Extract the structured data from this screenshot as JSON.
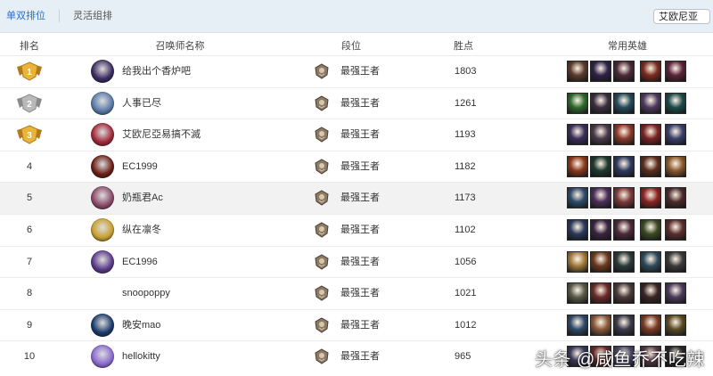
{
  "tabs": [
    {
      "label": "单双排位",
      "active": true
    },
    {
      "label": "灵活组排",
      "active": false
    }
  ],
  "server_select": {
    "value": "艾欧尼亚"
  },
  "columns": {
    "rank": "排名",
    "summoner": "召唤师名称",
    "tier": "段位",
    "points": "胜点",
    "heroes": "常用英雄"
  },
  "colors": {
    "accent": "#2b6fc2",
    "gold_medal": "#e8b43a",
    "silver_medal": "#b9b9b9",
    "row_highlight": "#f2f2f2"
  },
  "icons": {
    "tier": "challenger-crest-icon",
    "medal": "rank-medal-icon"
  },
  "rows": [
    {
      "rank": "1",
      "medal": "gold",
      "name": "给我出个香炉吧",
      "tier": "最强王者",
      "points": "1803",
      "avatar_color": "#3a2b5e",
      "heroes": [
        "#5b3b2c",
        "#2e2247",
        "#4a2a3a",
        "#7a2a1f",
        "#5a2438"
      ]
    },
    {
      "rank": "2",
      "medal": "silver",
      "name": "人事已尽",
      "tier": "最强王者",
      "points": "1261",
      "avatar_color": "#5a7aa8",
      "heroes": [
        "#2f6a2c",
        "#3a2f3f",
        "#244a5a",
        "#4e3a5e",
        "#1e4a4a"
      ]
    },
    {
      "rank": "3",
      "medal": "gold",
      "name": "艾欧尼亞易搞不滅",
      "tier": "最强王者",
      "points": "1193",
      "avatar_color": "#a02838",
      "heroes": [
        "#3a2f5a",
        "#4a3a4a",
        "#8a3a2a",
        "#7a2424",
        "#3a3f6a"
      ]
    },
    {
      "rank": "4",
      "medal": "",
      "name": "EC1999",
      "tier": "最强王者",
      "points": "1182",
      "avatar_color": "#6a1e14",
      "heroes": [
        "#8a3a1e",
        "#1e3a2e",
        "#2e3a5e",
        "#5a2e1e",
        "#8a5a2e"
      ]
    },
    {
      "rank": "5",
      "medal": "",
      "name": "奶瓶君Ac",
      "tier": "最强王者",
      "points": "1173",
      "avatar_color": "#8a4a6a",
      "heroes": [
        "#2e4a6a",
        "#4a2e5a",
        "#7a3a3a",
        "#8a2424",
        "#4a2a2a"
      ]
    },
    {
      "rank": "6",
      "medal": "",
      "name": "纵在凛冬",
      "tier": "最强王者",
      "points": "1102",
      "avatar_color": "#c8a030",
      "heroes": [
        "#2a3a5a",
        "#3a2440",
        "#4a2a3a",
        "#3a4a24",
        "#5a2e2e"
      ]
    },
    {
      "rank": "7",
      "medal": "",
      "name": "EC1996",
      "tier": "最强王者",
      "points": "1056",
      "avatar_color": "#5a3a8a",
      "heroes": [
        "#a07a3a",
        "#6a3a1e",
        "#2a3a3a",
        "#2e4a5a",
        "#3a3a3a"
      ]
    },
    {
      "rank": "8",
      "medal": "",
      "name": "snoopoppy",
      "tier": "最强王者",
      "points": "1021",
      "avatar_color": "",
      "heroes": [
        "#5a5a4a",
        "#6a2a2a",
        "#4a3a3a",
        "#3a2424",
        "#4a3a5a"
      ]
    },
    {
      "rank": "9",
      "medal": "",
      "name": "晚安mao",
      "tier": "最强王者",
      "points": "1012",
      "avatar_color": "#1a3a6a",
      "heroes": [
        "#2e4a6a",
        "#8a5a3a",
        "#3a3a4a",
        "#7a3a24",
        "#5a4a24"
      ]
    },
    {
      "rank": "10",
      "medal": "",
      "name": "hellokitty",
      "tier": "最强王者",
      "points": "965",
      "avatar_color": "#8a6ad0",
      "heroes": [
        "#3a3a5a",
        "#6a2a2a",
        "#4a4a6a",
        "#5a3a4a",
        "#2a2a2a"
      ]
    }
  ],
  "watermark": "头条 @咸鱼乔不吃辣"
}
